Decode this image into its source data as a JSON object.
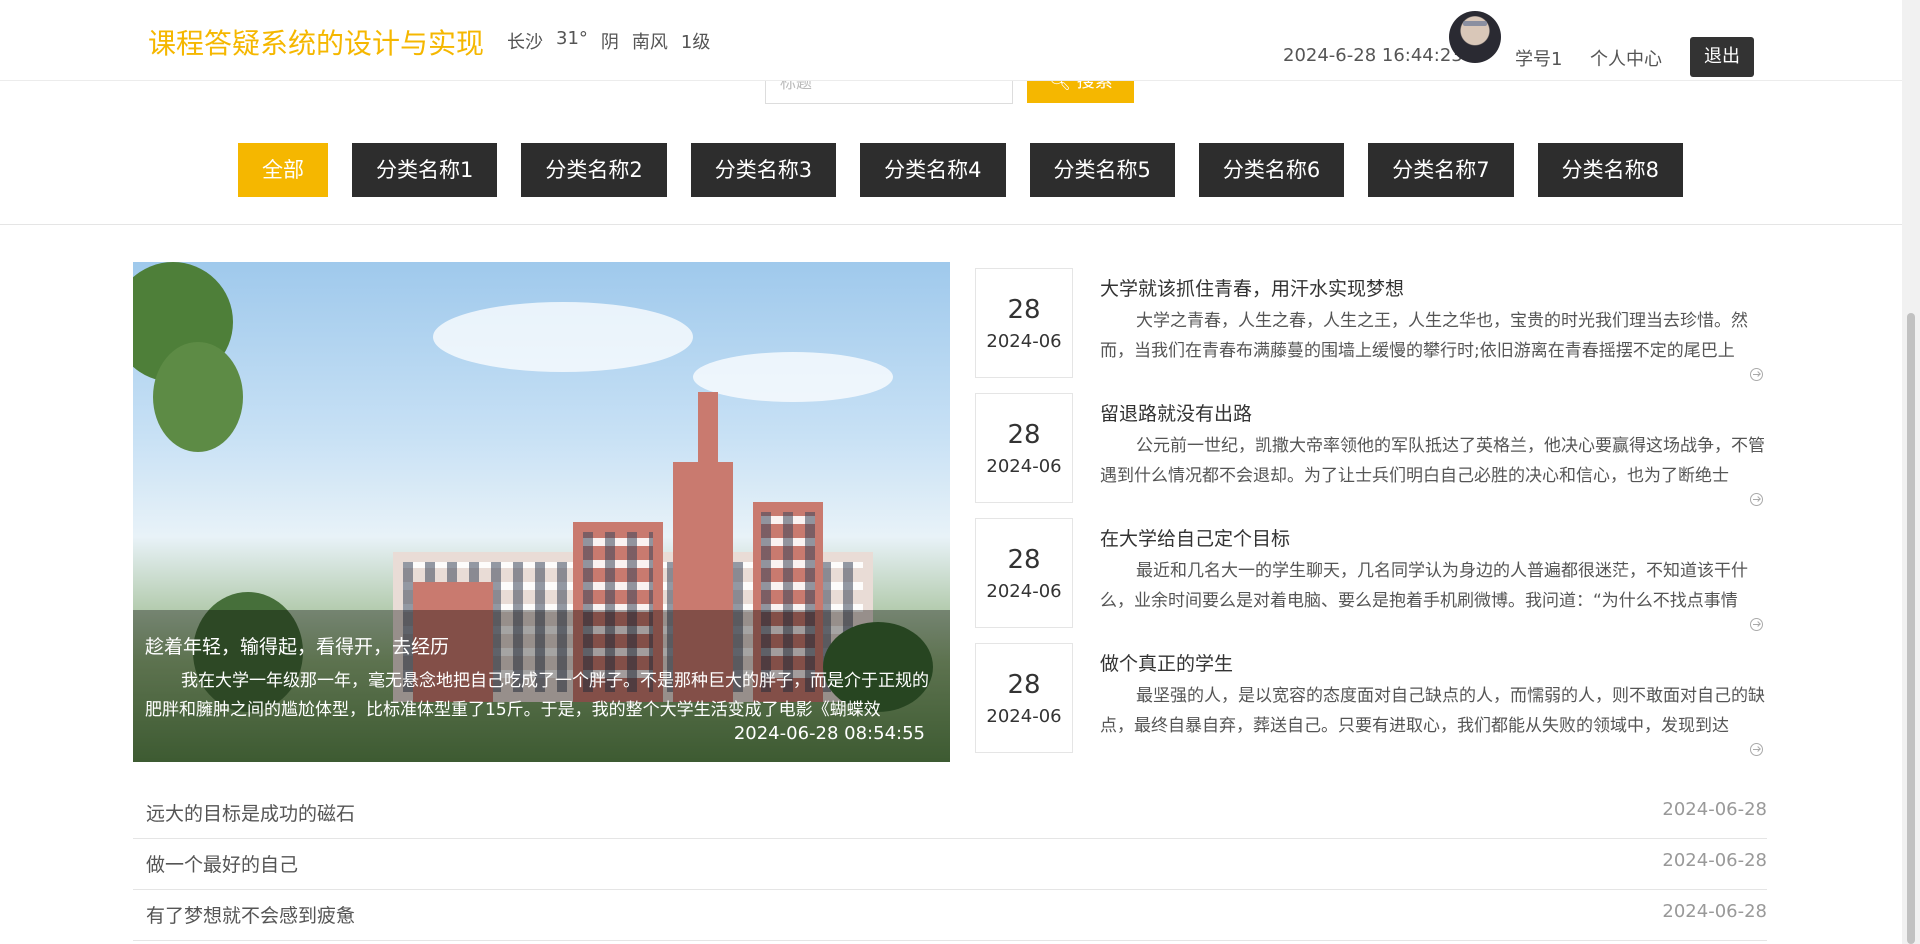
{
  "header": {
    "site_title": "课程答疑系统的设计与实现",
    "weather": {
      "city": "长沙",
      "temp": "31°",
      "condition": "阴",
      "wind": "南风",
      "level": "1级"
    },
    "datetime": "2024-6-28 16:44:23",
    "user_name": "学号1",
    "user_center": "个人中心",
    "logout": "退出"
  },
  "search": {
    "placeholder": "标题",
    "button_label": "搜索",
    "icon": "search-icon"
  },
  "categories": [
    "全部",
    "分类名称1",
    "分类名称2",
    "分类名称3",
    "分类名称4",
    "分类名称5",
    "分类名称6",
    "分类名称7",
    "分类名称8"
  ],
  "active_category": "全部",
  "feature": {
    "title": "趁着年轻，输得起，看得开，去经历",
    "summary": "我在大学一年级那一年，毫无悬念地把自己吃成了一个胖子。不是那种巨大的胖子，而是介于正规的肥胖和臃肿之间的尴尬体型，比标准体型重了15斤。于是，我的整个大学生活变成了电影《蝴蝶效",
    "time": "2024-06-28 08:54:55"
  },
  "news": [
    {
      "day": "28",
      "ym": "2024-06",
      "title": "大学就该抓住青春，用汗水实现梦想",
      "summary": "大学之青春，人生之春，人生之王，人生之华也，宝贵的时光我们理当去珍惜。然而，当我们在青春布满藤蔓的围墙上缓慢的攀行时;依旧游离在青春摇摆不定的尾巴上"
    },
    {
      "day": "28",
      "ym": "2024-06",
      "title": "留退路就没有出路",
      "summary": "公元前一世纪，凯撒大帝率领他的军队抵达了英格兰，他决心要赢得这场战争，不管遇到什么情况都不会退却。为了让士兵们明白自己必胜的决心和信心，也为了断绝士"
    },
    {
      "day": "28",
      "ym": "2024-06",
      "title": "在大学给自己定个目标",
      "summary": "最近和几名大一的学生聊天，几名同学认为身边的人普遍都很迷茫，不知道该干什么，业余时间要么是对着电脑、要么是抱着手机刷微博。我问道：“为什么不找点事情"
    },
    {
      "day": "28",
      "ym": "2024-06",
      "title": "做个真正的学生",
      "summary": "最坚强的人，是以宽容的态度面对自己缺点的人，而懦弱的人，则不敢面对自己的缺点，最终自暴自弃，葬送自己。只要有进取心，我们都能从失败的领域中，发现到达"
    }
  ],
  "list": [
    {
      "title": "远大的目标是成功的磁石",
      "date": "2024-06-28"
    },
    {
      "title": "做一个最好的自己",
      "date": "2024-06-28"
    },
    {
      "title": "有了梦想就不会感到疲惫",
      "date": "2024-06-28"
    }
  ],
  "colors": {
    "accent": "#f5b700",
    "dark_button": "#2d2d2d"
  }
}
